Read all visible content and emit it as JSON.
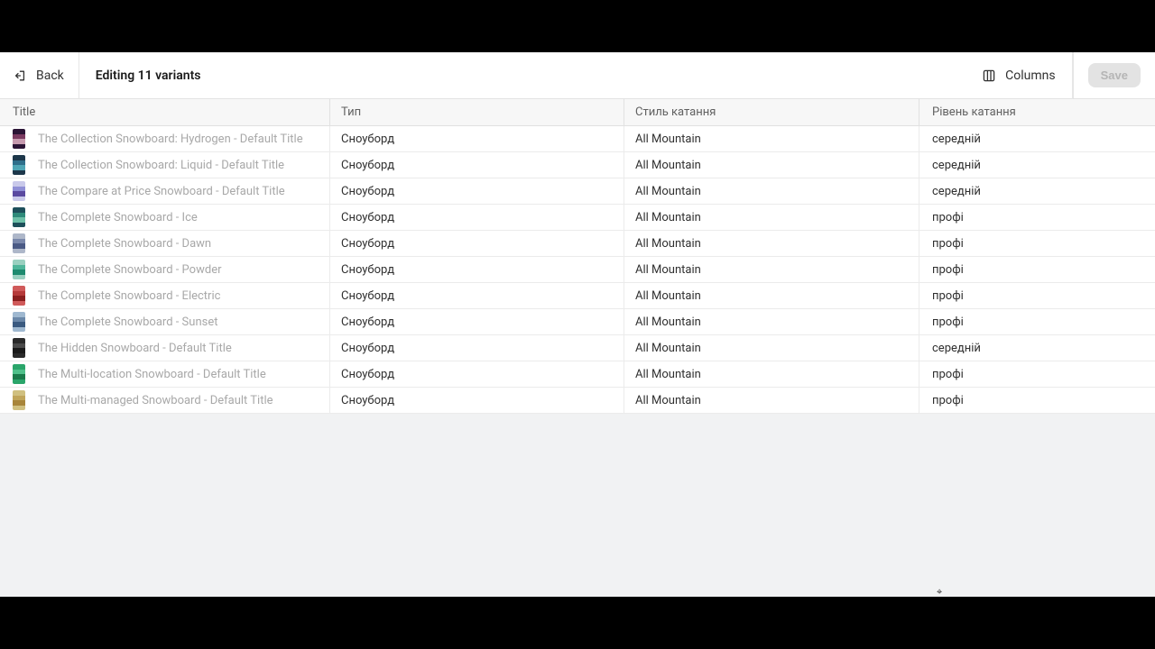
{
  "topbar": {
    "back_label": "Back",
    "title": "Editing 11 variants",
    "columns_label": "Columns",
    "save_label": "Save"
  },
  "columns": {
    "title": "Title",
    "type": "Тип",
    "style": "Стиль катання",
    "level": "Рівень катання"
  },
  "rows": [
    {
      "title": "The Collection Snowboard: Hydrogen - Default Title",
      "type": "Сноуборд",
      "style": "All Mountain",
      "level": "середній",
      "colors": [
        "#2b1435",
        "#7a3a60",
        "#c79aaf",
        "#2b1435"
      ]
    },
    {
      "title": "The Collection Snowboard: Liquid - Default Title",
      "type": "Сноуборд",
      "style": "All Mountain",
      "level": "середній",
      "colors": [
        "#1d374a",
        "#2f6f8b",
        "#4fa5b5",
        "#1d374a"
      ]
    },
    {
      "title": "The Compare at Price Snowboard - Default Title",
      "type": "Сноуборд",
      "style": "All Mountain",
      "level": "середній",
      "colors": [
        "#c9c9ea",
        "#8f8fd6",
        "#5a4aa0",
        "#c9c9ea"
      ]
    },
    {
      "title": "The Complete Snowboard - Ice",
      "type": "Сноуборд",
      "style": "All Mountain",
      "level": "профі",
      "colors": [
        "#1d4f5a",
        "#2e8a7a",
        "#6dc0a8",
        "#1d4f5a"
      ]
    },
    {
      "title": "The Complete Snowboard - Dawn",
      "type": "Сноуборд",
      "style": "All Mountain",
      "level": "профі",
      "colors": [
        "#aeb7c9",
        "#7a88ab",
        "#4a5a85",
        "#aeb7c9"
      ]
    },
    {
      "title": "The Complete Snowboard - Powder",
      "type": "Сноуборд",
      "style": "All Mountain",
      "level": "профі",
      "colors": [
        "#9ad0c0",
        "#4fb59a",
        "#1e8a6f",
        "#9ad0c0"
      ]
    },
    {
      "title": "The Complete Snowboard - Electric",
      "type": "Сноуборд",
      "style": "All Mountain",
      "level": "профі",
      "colors": [
        "#d05a5a",
        "#b63a3a",
        "#8a1f1f",
        "#d05a5a"
      ]
    },
    {
      "title": "The Complete Snowboard - Sunset",
      "type": "Сноуборд",
      "style": "All Mountain",
      "level": "профі",
      "colors": [
        "#9fb8d0",
        "#6a87a8",
        "#3a5a80",
        "#9fb8d0"
      ]
    },
    {
      "title": "The Hidden Snowboard - Default Title",
      "type": "Сноуборд",
      "style": "All Mountain",
      "level": "середній",
      "colors": [
        "#2a2a2a",
        "#4a4a4a",
        "#1a1a1a",
        "#2a2a2a"
      ]
    },
    {
      "title": "The Multi-location Snowboard - Default Title",
      "type": "Сноуборд",
      "style": "All Mountain",
      "level": "профі",
      "colors": [
        "#2aa56a",
        "#4fc08a",
        "#1a7a4a",
        "#2aa56a"
      ]
    },
    {
      "title": "The Multi-managed Snowboard - Default Title",
      "type": "Сноуборд",
      "style": "All Mountain",
      "level": "профі",
      "colors": [
        "#d0c080",
        "#c0a55a",
        "#a8853a",
        "#d0c080"
      ]
    }
  ]
}
